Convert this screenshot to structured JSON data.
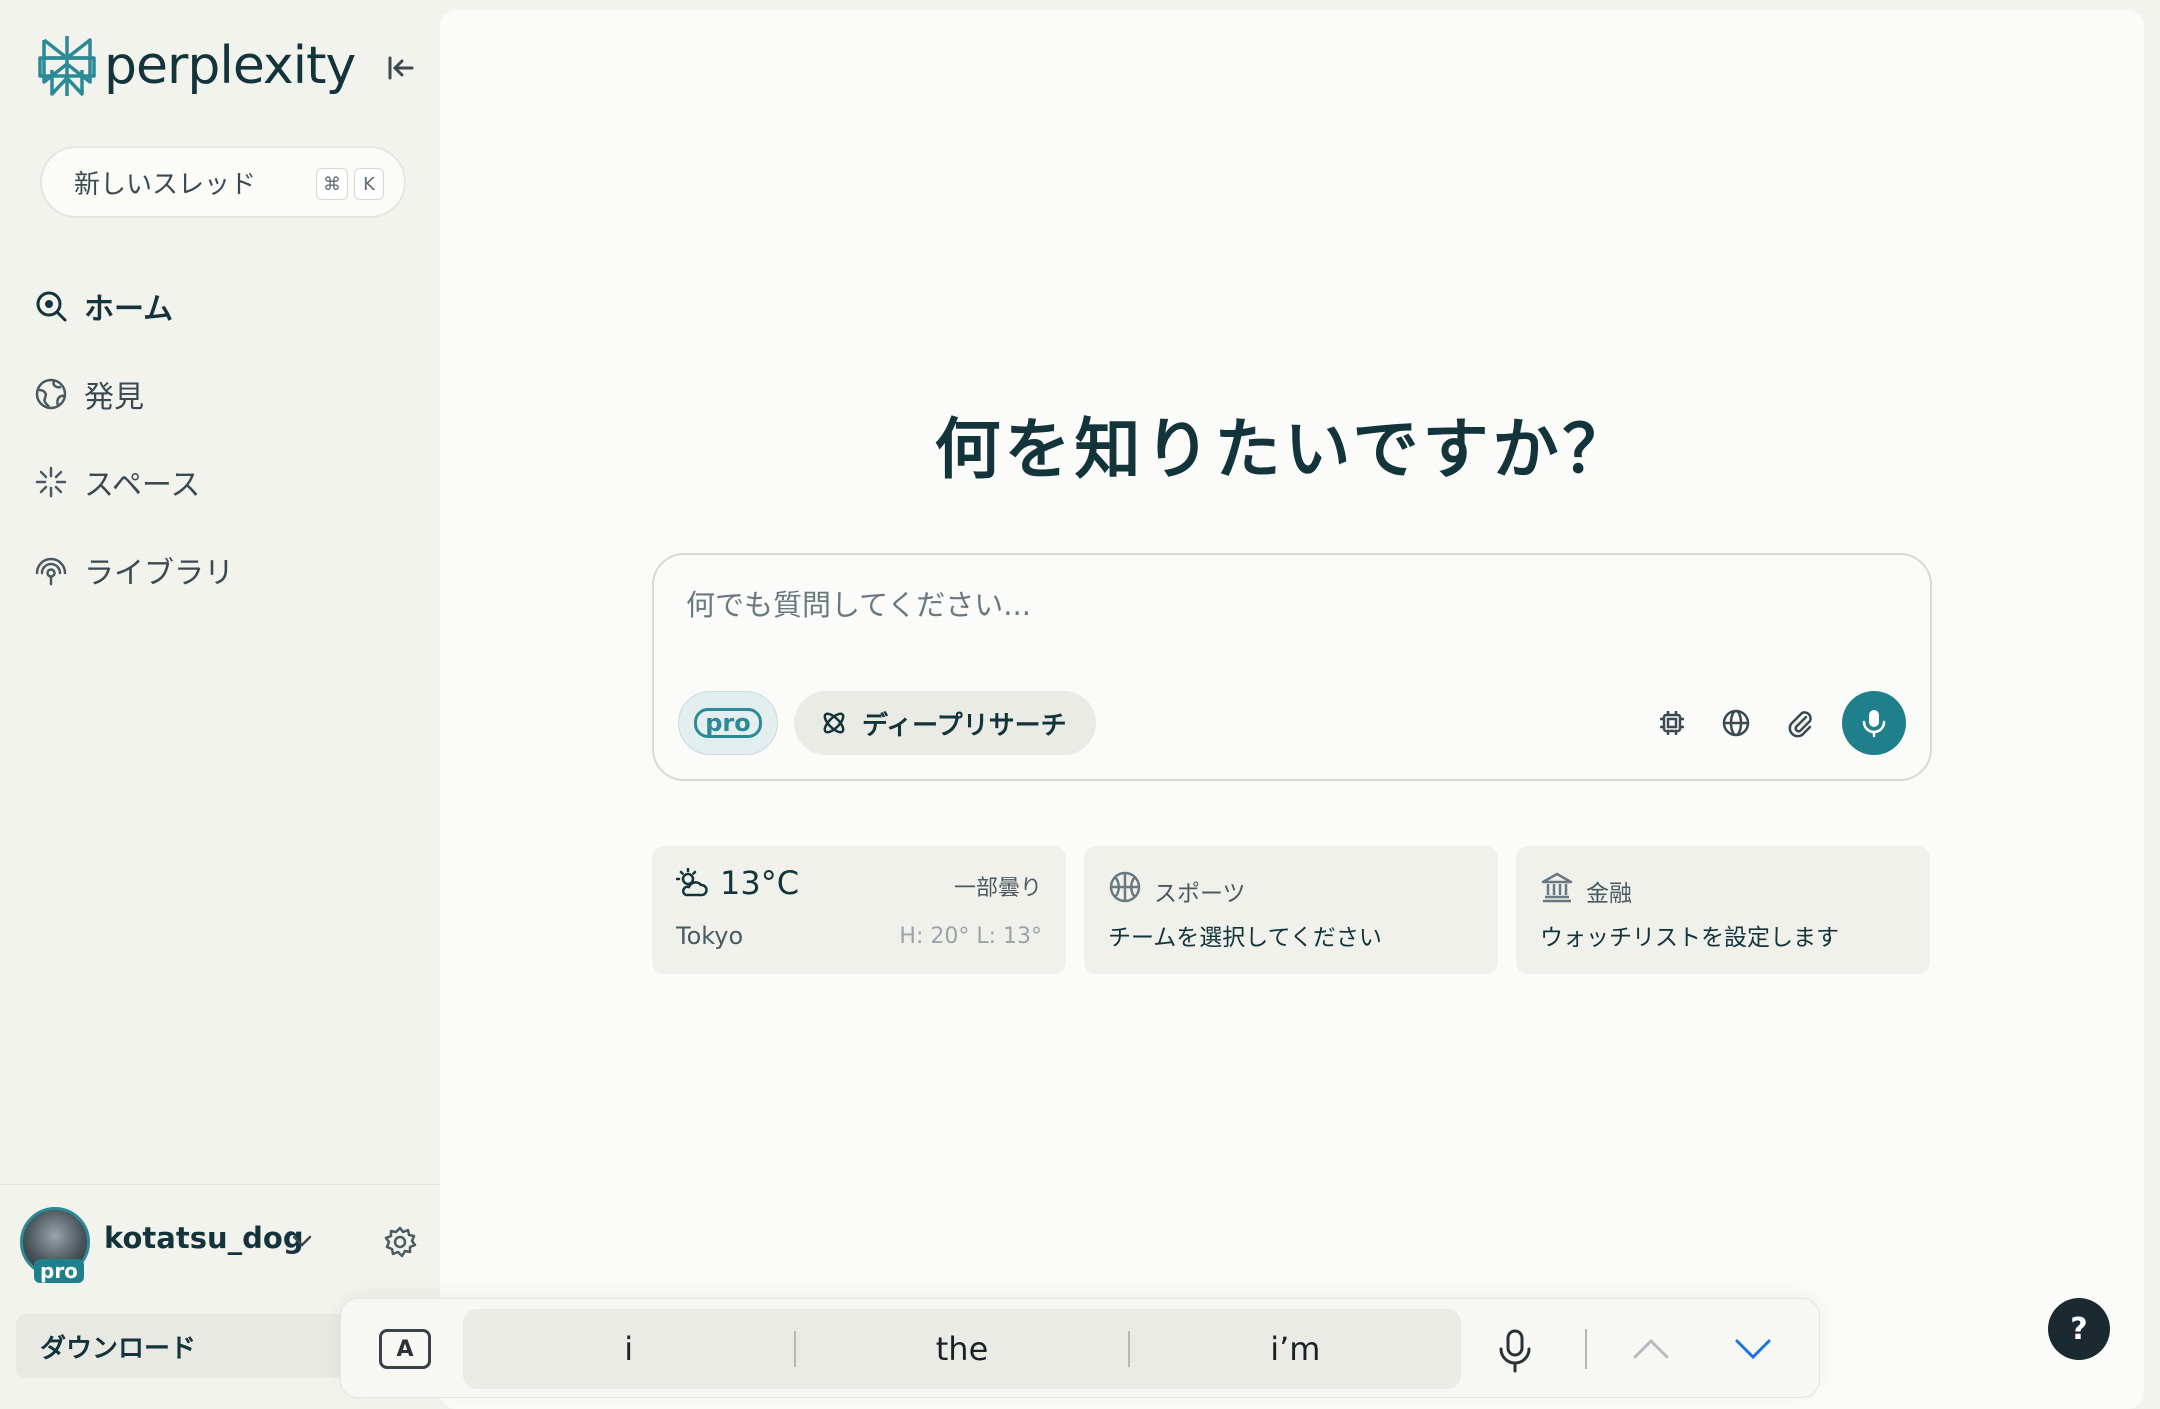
{
  "app": {
    "logo_text": "perplexity",
    "accent_color": "#1f7f8a"
  },
  "sidebar": {
    "new_thread_label": "新しいスレッド",
    "shortcut_keys": [
      "⌘",
      "K"
    ],
    "items": [
      {
        "label": "ホーム",
        "icon": "home-search-icon",
        "active": true
      },
      {
        "label": "発見",
        "icon": "globe-icon",
        "active": false
      },
      {
        "label": "スペース",
        "icon": "sparkle-icon",
        "active": false
      },
      {
        "label": "ライブラリ",
        "icon": "library-icon",
        "active": false
      }
    ],
    "user": {
      "name": "kotatsu_dog",
      "badge": "pro"
    },
    "download_label": "ダウンロード"
  },
  "main": {
    "headline": "何を知りたいですか？",
    "ask": {
      "placeholder": "何でも質問してください...",
      "pro_label": "pro",
      "deep_research_label": "ディープリサーチ"
    },
    "widgets": {
      "weather": {
        "temp": "13°C",
        "condition": "一部曇り",
        "city": "Tokyo",
        "high_low": "H: 20° L: 13°"
      },
      "sports": {
        "title": "スポーツ",
        "subtitle": "チームを選択してください"
      },
      "finance": {
        "title": "金融",
        "subtitle": "ウォッチリストを設定します"
      }
    }
  },
  "keyboard_bar": {
    "input_mode": "A",
    "suggestions": [
      "i",
      "the",
      "i’m"
    ]
  },
  "help_label": "?"
}
